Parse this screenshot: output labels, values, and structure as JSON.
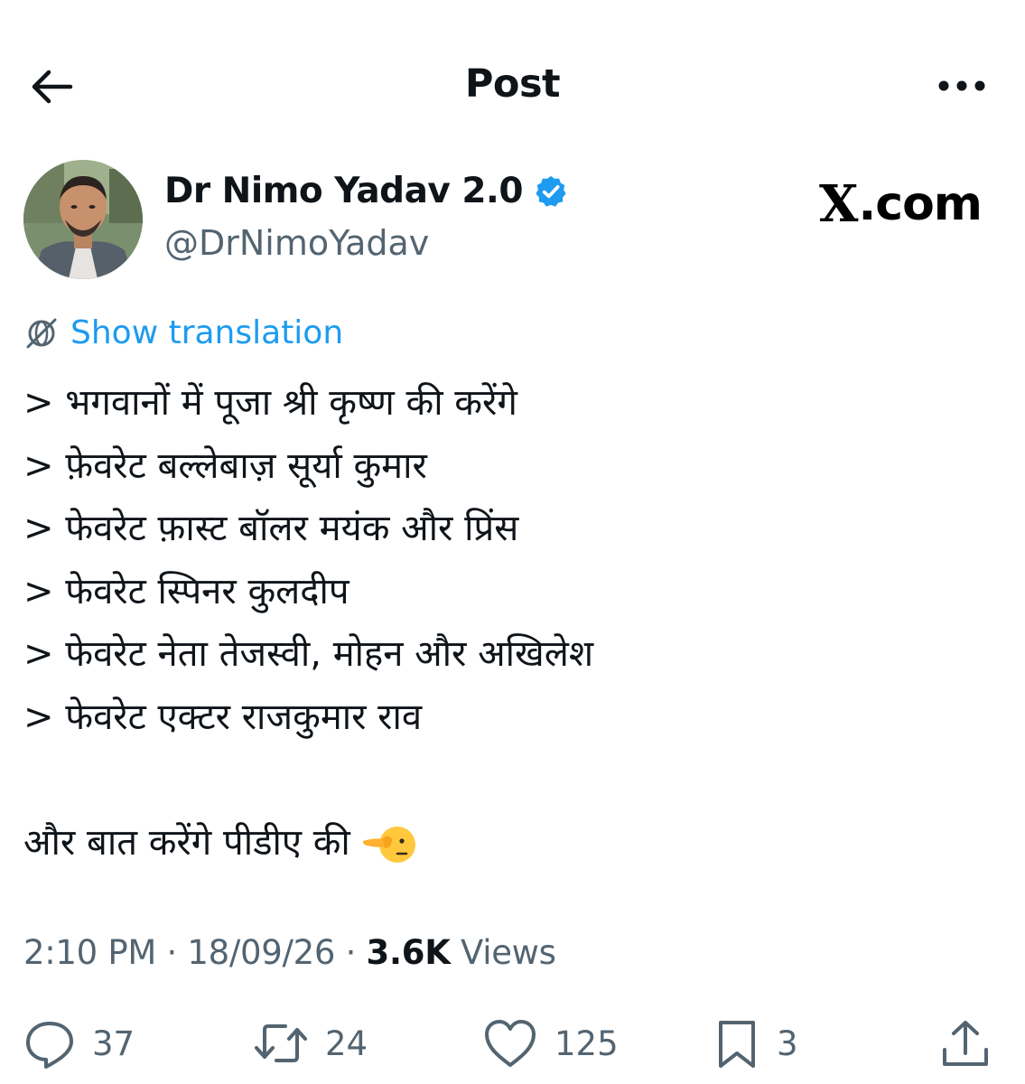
{
  "header": {
    "title": "Post",
    "back_icon": "arrow-left-icon",
    "more_icon": "more-horizontal-icon"
  },
  "author": {
    "display_name": "Dr Nimo Yadav 2.0",
    "handle": "@DrNimoYadav",
    "verified": true,
    "verified_color": "#1d9bf0"
  },
  "watermark": {
    "x_letter": "X",
    "domain_suffix": ".com"
  },
  "translation": {
    "label": "Show translation",
    "icon": "globe-icon"
  },
  "tweet": {
    "lines": [
      "> भगवानों में पूजा श्री कृष्ण की करेंगे",
      "> फ़ेवरेट बल्लेबाज़ सूर्या कुमार",
      "> फेवरेट फ़ास्ट बॉलर मयंक और प्रिंस",
      "> फेवरेट स्पिनर कुलदीप",
      "> फेवरेट नेता तेजस्वी, मोहन और अखिलेश",
      "> फेवरेट एक्टर राजकुमार राव"
    ],
    "closing": "और बात करेंगे पीडीए की",
    "closing_emoji": "pointing-face-emoji"
  },
  "meta": {
    "time": "2:10 PM",
    "sep1": " · ",
    "date": "18/09/26",
    "sep2": " · ",
    "views_count": "3.6K",
    "views_label": " Views"
  },
  "actions": {
    "replies": "37",
    "reposts": "24",
    "likes": "125",
    "bookmarks": "3"
  },
  "colors": {
    "text": "#0f1419",
    "muted": "#536471",
    "accent": "#1d9bf0"
  }
}
